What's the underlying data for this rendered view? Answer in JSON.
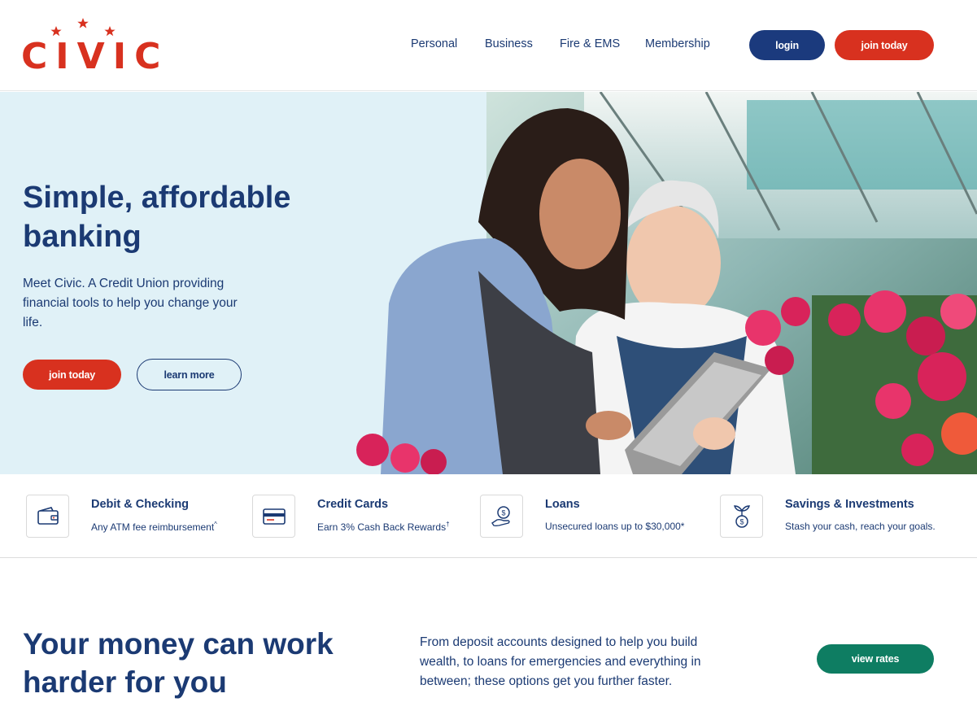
{
  "brand": {
    "name": "CIVIC",
    "tm": "™",
    "red": "#d8311f",
    "navy": "#1b3a7d",
    "green": "#0e7d62"
  },
  "nav": {
    "items": [
      "Personal",
      "Business",
      "Fire & EMS",
      "Membership"
    ],
    "login_label": "login",
    "join_label": "join today"
  },
  "hero": {
    "title": "Simple, affordable banking",
    "subtitle": "Meet Civic. A Credit Union providing financial tools to help you change your life.",
    "join_label": "join today",
    "learn_label": "learn more"
  },
  "products": [
    {
      "title": "Debit & Checking",
      "desc": "Any ATM fee reimbursement",
      "mark": "^",
      "icon": "wallet-icon"
    },
    {
      "title": "Credit Cards",
      "desc": "Earn 3% Cash Back Rewards",
      "mark": "†",
      "icon": "credit-card-icon"
    },
    {
      "title": "Loans",
      "desc": "Unsecured loans up to $30,000*",
      "mark": "",
      "icon": "hand-dollar-icon"
    },
    {
      "title": "Savings & Investments",
      "desc": "Stash your cash, reach your goals.",
      "mark": "",
      "icon": "money-plant-icon"
    }
  ],
  "bottom": {
    "title": "Your money can work harder for you",
    "text": "From deposit accounts designed to help you build wealth, to loans for emergencies and everything in between; these options get you further faster.",
    "rates_label": "view rates"
  }
}
